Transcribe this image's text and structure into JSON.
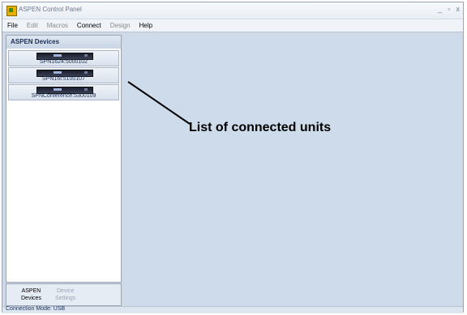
{
  "window": {
    "title": "ASPEN Control Panel",
    "controls": {
      "minimize": "_",
      "maximize": "▫",
      "close": "x"
    }
  },
  "menu": {
    "items": [
      {
        "label": "File",
        "enabled": true
      },
      {
        "label": "Edit",
        "enabled": false
      },
      {
        "label": "Macros",
        "enabled": false
      },
      {
        "label": "Connect",
        "enabled": true
      },
      {
        "label": "Design",
        "enabled": false
      },
      {
        "label": "Help",
        "enabled": true
      }
    ]
  },
  "left_panel": {
    "header": "ASPEN Devices",
    "devices": [
      {
        "label": "SPN1624:5000102",
        "icon": "rack-unit-icon"
      },
      {
        "label": "SPN16i:5100107",
        "icon": "rack-unit-icon"
      },
      {
        "label": "SPNConference:5300109",
        "icon": "rack-unit-icon"
      }
    ],
    "tabs": {
      "aspen_devices": {
        "line1": "ASPEN",
        "line2": "Devices"
      },
      "device_settings": {
        "line1": "Device",
        "line2": "Settings"
      }
    }
  },
  "status": {
    "text": "Connection Mode: USB"
  },
  "annotation": {
    "text": "List of connected units"
  },
  "colors": {
    "main_background": "#cddbea",
    "panel_header": "#1a2e55",
    "disabled_text": "#8a8a8a"
  }
}
